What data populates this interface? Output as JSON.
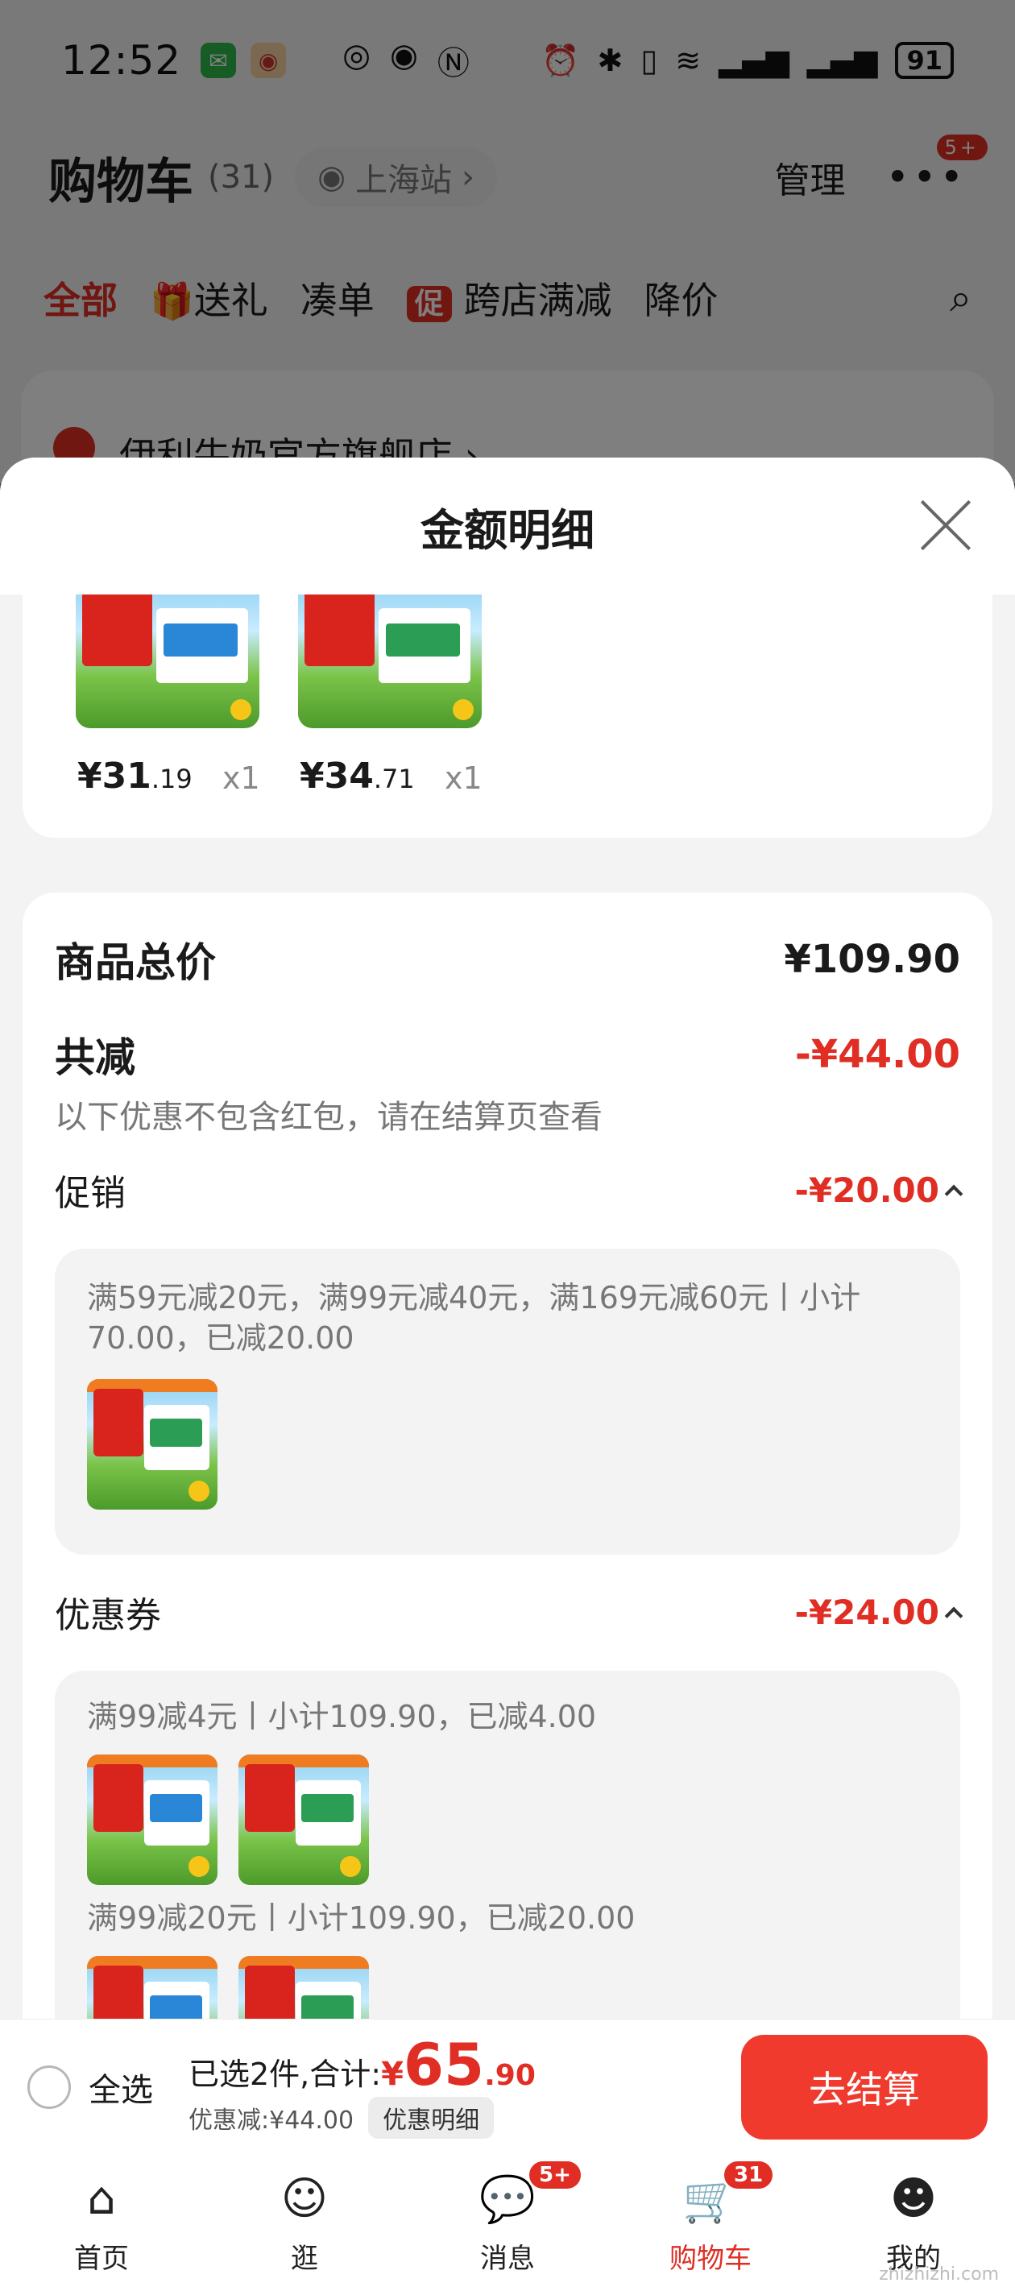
{
  "status_bar": {
    "time": "12:52",
    "battery": "91"
  },
  "cart_header": {
    "title": "购物车",
    "count": "(31)",
    "station": "上海站",
    "station_chevron": "›",
    "manage": "管理",
    "more_badge": "5+"
  },
  "filter_tabs": {
    "all": "全部",
    "gift": "送礼",
    "combine": "凑单",
    "promo_icon": "促",
    "cross_store": "跨店满减",
    "price_drop": "降价"
  },
  "store": {
    "name": "伊利牛奶官方旗舰店 ›"
  },
  "sheet": {
    "title": "金额明细",
    "products": [
      {
        "price_int": "¥31",
        "price_dec": ".19",
        "qty": "x1"
      },
      {
        "price_int": "¥34",
        "price_dec": ".71",
        "qty": "x1"
      }
    ],
    "subtotal_label": "商品总价",
    "subtotal_value": "¥109.90",
    "discount_label": "共减",
    "discount_value": "-¥44.00",
    "discount_note": "以下优惠不包含红包，请在结算页查看",
    "promo": {
      "label": "促销",
      "value": "-¥20.00",
      "detail": "满59元减20元，满99元减40元，满169元减60元丨小计70.00，已减20.00"
    },
    "coupon": {
      "label": "优惠券",
      "value": "-¥24.00",
      "detail_1": "满99减4元丨小计109.90，已减4.00",
      "detail_2": "满99减20元丨小计109.90，已减20.00"
    }
  },
  "checkout": {
    "select_all": "全选",
    "selected_text": "已选2件,合计:",
    "currency": "¥",
    "total_int": "65",
    "total_dec": ".90",
    "discount_text": "优惠减:¥44.00",
    "detail_button": "优惠明细",
    "checkout_button": "去结算"
  },
  "tabbar": {
    "items": [
      {
        "label": "首页",
        "icon": "home-icon"
      },
      {
        "label": "逛",
        "icon": "browse-icon"
      },
      {
        "label": "消息",
        "icon": "message-icon",
        "badge": "5+"
      },
      {
        "label": "购物车",
        "icon": "cart-icon",
        "badge": "31"
      },
      {
        "label": "我的",
        "icon": "profile-icon"
      }
    ]
  },
  "watermark": "zhizhizhi.com",
  "colors": {
    "accent": "#e02e24",
    "checkout_button": "#f03a2e"
  }
}
